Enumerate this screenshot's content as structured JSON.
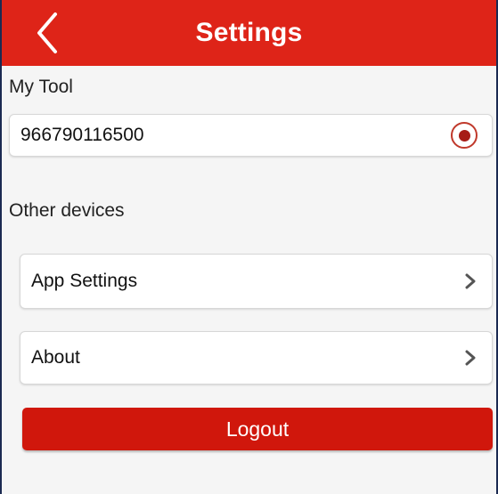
{
  "header": {
    "title": "Settings",
    "background_color": "#de2418",
    "back_icon": "chevron-left-icon"
  },
  "my_tool": {
    "label": "My Tool",
    "serial": "966790116500",
    "selected": true,
    "radio_icon": "radio-selected-icon"
  },
  "other_devices": {
    "label": "Other devices"
  },
  "menu": {
    "items": [
      {
        "label": "App Settings",
        "icon": "chevron-right-icon"
      },
      {
        "label": "About",
        "icon": "chevron-right-icon"
      }
    ]
  },
  "logout": {
    "label": "Logout",
    "color": "#d0170c"
  }
}
